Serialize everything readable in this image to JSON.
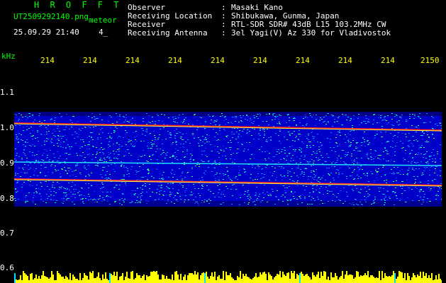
{
  "header": {
    "title": "H R O F F T",
    "filename": "UT2509292140.png",
    "meteor_label": "meteor",
    "datetime": "25.09.29 21:40",
    "count": "4_",
    "fields": [
      {
        "label": "Observer",
        "value": "Masaki Kano"
      },
      {
        "label": "Receiving Location",
        "value": "Shibukawa, Gunma, Japan"
      },
      {
        "label": "Receiver",
        "value": "RTL-SDR SDR# 43dB L15 103.2MHz CW"
      },
      {
        "label": "Receiving Antenna",
        "value": "3el Yagi(V) Az 330 for Vladivostok"
      }
    ],
    "colon": ":"
  },
  "axes": {
    "y_unit": "kHz",
    "y_ticks": [
      "1.1",
      "1.0",
      "0.9",
      "0.8",
      "0.7",
      "0.6"
    ],
    "x_ticks": [
      "214",
      "214",
      "214",
      "214",
      "214",
      "214",
      "214",
      "214",
      "214",
      "2150"
    ]
  },
  "colors": {
    "background": "#000000",
    "label_green": "#00ff00",
    "text_white": "#ffffff",
    "tick_yellow": "#ffff00",
    "noise_blue": "#0000d8",
    "echo_red": "#ff2020"
  }
}
